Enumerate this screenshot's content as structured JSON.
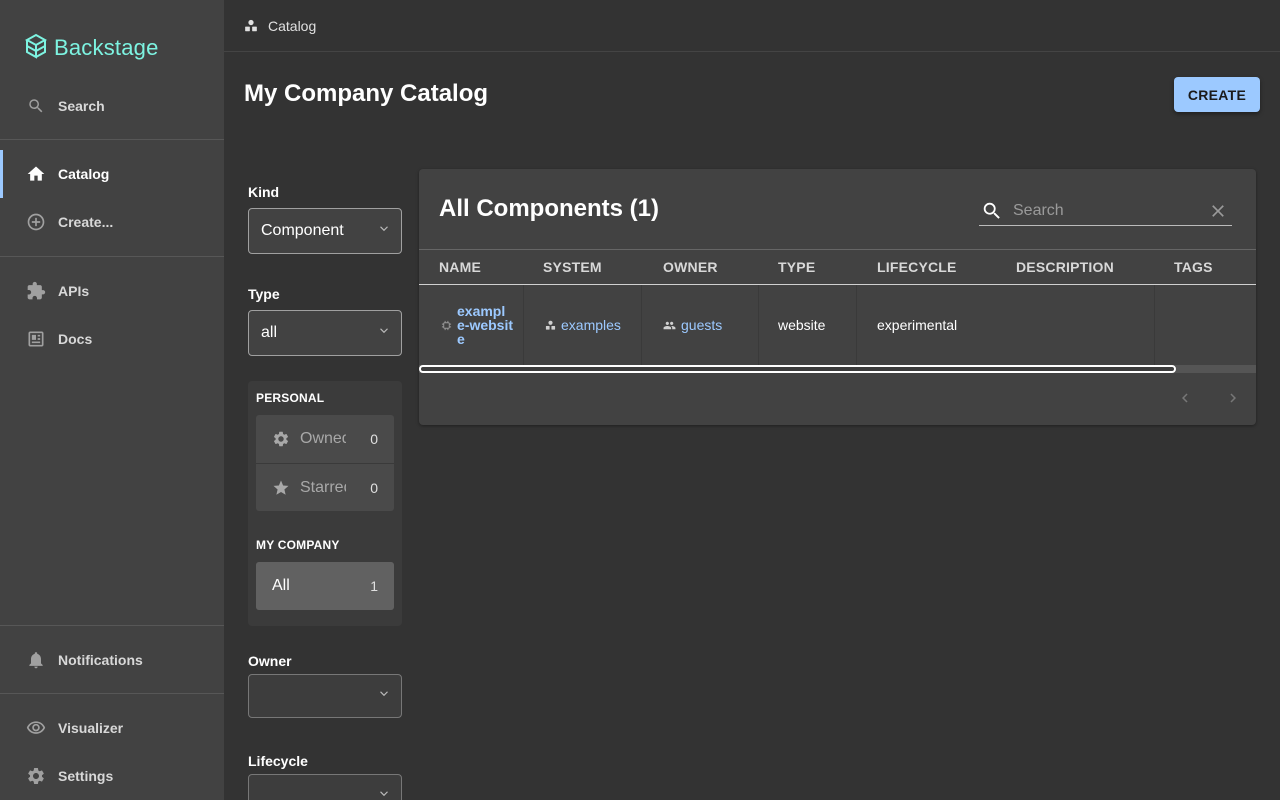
{
  "sidebar": {
    "logo_text": "Backstage",
    "items": [
      {
        "label": "Search",
        "icon": "search-icon"
      },
      {
        "label": "Catalog",
        "icon": "home-icon",
        "active": true
      },
      {
        "label": "Create...",
        "icon": "add-circle-icon"
      },
      {
        "label": "APIs",
        "icon": "extension-icon"
      },
      {
        "label": "Docs",
        "icon": "docs-icon"
      },
      {
        "label": "Notifications",
        "icon": "bell-icon"
      },
      {
        "label": "Visualizer",
        "icon": "eye-icon"
      },
      {
        "label": "Settings",
        "icon": "gear-icon"
      }
    ],
    "accent_color": "#7df3e1"
  },
  "header": {
    "breadcrumb": "Catalog",
    "title": "My Company Catalog",
    "create_label": "CREATE"
  },
  "filters": {
    "kind_label": "Kind",
    "kind_value": "Component",
    "type_label": "Type",
    "type_value": "all",
    "personal_title": "PERSONAL",
    "personal_items": [
      {
        "label": "Owned",
        "count": "0",
        "icon": "gear-icon"
      },
      {
        "label": "Starred",
        "count": "0",
        "icon": "star-icon"
      }
    ],
    "company_title": "MY COMPANY",
    "company_items": [
      {
        "label": "All",
        "count": "1"
      }
    ],
    "owner_label": "Owner",
    "lifecycle_label": "Lifecycle"
  },
  "table": {
    "title": "All Components (1)",
    "search_placeholder": "Search",
    "columns": [
      "NAME",
      "SYSTEM",
      "OWNER",
      "TYPE",
      "LIFECYCLE",
      "DESCRIPTION",
      "TAGS"
    ],
    "rows": [
      {
        "name": "example-website",
        "system": "examples",
        "owner": "guests",
        "type": "website",
        "lifecycle": "experimental",
        "description": "",
        "tags": ""
      }
    ]
  },
  "colors": {
    "primary": "#9cc9ff",
    "sidebar_bg": "#424242",
    "page_bg": "#333333"
  }
}
